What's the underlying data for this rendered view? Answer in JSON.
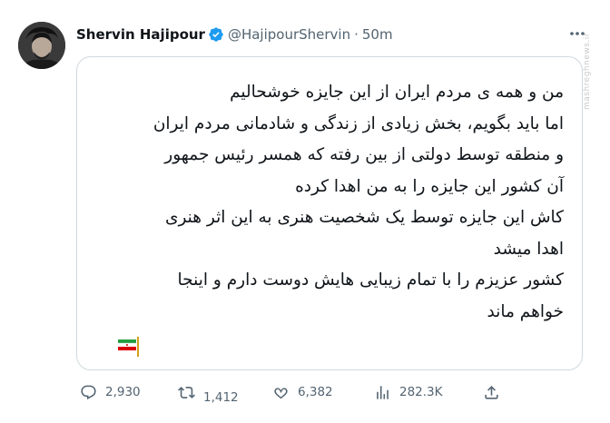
{
  "author": {
    "display_name": "Shervin Hajipour",
    "handle": "@HajipourShervin",
    "time": "50m",
    "verified": true,
    "avatar_icon": "profile-photo"
  },
  "tweet": {
    "lines": [
      "من و همه ی مردم ایران از این جایزه خوشحالیم",
      "اما باید بگویم، بخش زیادی از زندگی و شادمانی مردم ایران",
      "و منطقه توسط دولتی از بین رفته که همسر رئیس جمهور",
      "آن کشور این جایزه را به من اهدا کرده",
      "کاش این جایزه توسط یک شخصیت هنری به این اثر هنری",
      "اهدا میشد",
      "کشور عزیزم را با تمام زیبایی هایش دوست دارم و اینجا",
      "خواهم ماند"
    ],
    "emoji": "iran-flag"
  },
  "actions": {
    "reply_count": "2,930",
    "retweet_count": "1,412",
    "like_count": "6,382",
    "views_count": "282.3K"
  },
  "watermark": "mashreghnews.ir",
  "colors": {
    "text": "#0f1419",
    "muted": "#536471",
    "border": "#cfd9de",
    "verified": "#1d9bf0"
  }
}
